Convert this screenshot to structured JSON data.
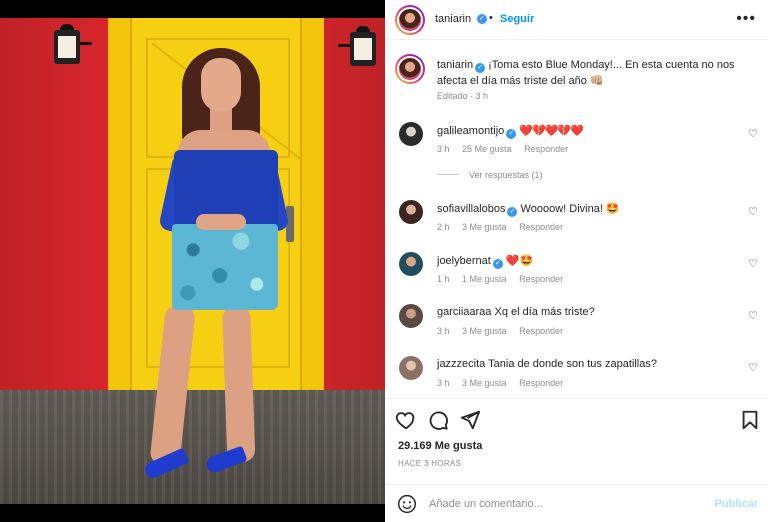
{
  "post": {
    "username": "taniarin",
    "follow_label": "Seguir",
    "dot": "•",
    "more_label": "•••"
  },
  "caption": {
    "username": "taniarin",
    "text": "¡Toma esto Blue Monday!... En esta cuenta no nos afecta el día más triste del año 👊🏼",
    "meta": "Editado · 3 h"
  },
  "comments": [
    {
      "username": "galileamontijo",
      "verified": true,
      "text": "❤️💔❤️💔❤️",
      "time": "3 h",
      "likes": "25 Me gusta",
      "reply": "Responder"
    },
    {
      "username": "sofiavillalobos",
      "verified": true,
      "text": "Woooow! Divina! 🤩",
      "time": "2 h",
      "likes": "3 Me gusta",
      "reply": "Responder"
    },
    {
      "username": "joelybernat",
      "verified": true,
      "text": "❤️🤩",
      "time": "1 h",
      "likes": "1 Me gusta",
      "reply": "Responder"
    },
    {
      "username": "garciiaaraa",
      "verified": false,
      "text": "Xq el día más triste?",
      "time": "3 h",
      "likes": "3 Me gusta",
      "reply": "Responder"
    },
    {
      "username": "jazzzecita",
      "verified": false,
      "text": "Tania de donde son tus zapatillas?",
      "time": "3 h",
      "likes": "3 Me gusta",
      "reply": "Responder"
    }
  ],
  "view_replies": "Ver respuestas (1)",
  "likes_count": "29.169 Me gusta",
  "time_ago": "HACE 3 HORAS",
  "add_comment": {
    "placeholder": "Añade un comentario...",
    "publish_label": "Publicar"
  },
  "icons": {
    "like": "heart-icon",
    "comment": "comment-icon",
    "share": "share-icon",
    "save": "bookmark-icon",
    "emoji": "emoji-icon",
    "verified": "verified-badge-icon",
    "more": "more-options-icon"
  },
  "colors": {
    "accent": "#0095f6",
    "verified": "#3897f0",
    "secondary_text": "#8e8e8e",
    "publish_disabled": "#b2dffc"
  }
}
